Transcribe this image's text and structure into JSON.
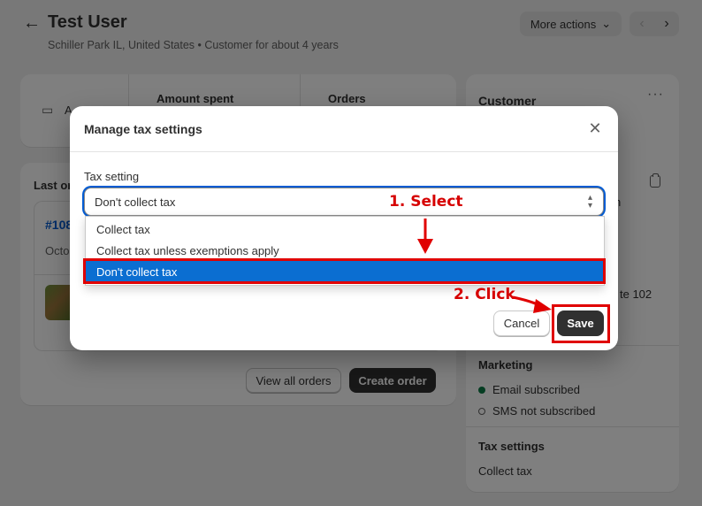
{
  "header": {
    "title": "Test User",
    "subtitle": "Schiller Park IL, United States • Customer for about 4 years",
    "more_actions_label": "More actions"
  },
  "stats": {
    "first_label": "A",
    "amount_spent_label": "Amount spent",
    "orders_label": "Orders"
  },
  "last_order": {
    "title": "Last or",
    "number": "#108",
    "date": "Octo",
    "view_all_label": "View all orders",
    "create_order_label": "Create order"
  },
  "customer": {
    "title": "Customer",
    "partial_name": "n",
    "partial_address_line": "te 102",
    "partial_address_line2": "s",
    "marketing_title": "Marketing",
    "email_status": "Email subscribed",
    "sms_status": "SMS not subscribed",
    "tax_title": "Tax settings",
    "tax_value": "Collect tax"
  },
  "modal": {
    "title": "Manage tax settings",
    "field_label": "Tax setting",
    "selected_value": "Don't collect tax",
    "options": [
      "Collect tax",
      "Collect tax unless exemptions apply",
      "Don't collect tax"
    ],
    "cancel_label": "Cancel",
    "save_label": "Save"
  },
  "annotations": {
    "step1": "1. Select",
    "step2": "2. Click",
    "color": "#e00000"
  },
  "icons": {
    "back": "arrow-left-icon",
    "more_actions_chevron": "chevron-down-icon",
    "prev": "chevron-left-icon",
    "next": "chevron-right-icon",
    "close": "close-icon",
    "select": "select-chevron-icon",
    "copy": "copy-icon",
    "more": "dots-icon"
  },
  "colors": {
    "primary_button": "#303030",
    "link": "#005bd3",
    "focus_ring": "#005bd3",
    "selected_option": "#0b6ed1",
    "subscribed_dot": "#0a7a45"
  }
}
